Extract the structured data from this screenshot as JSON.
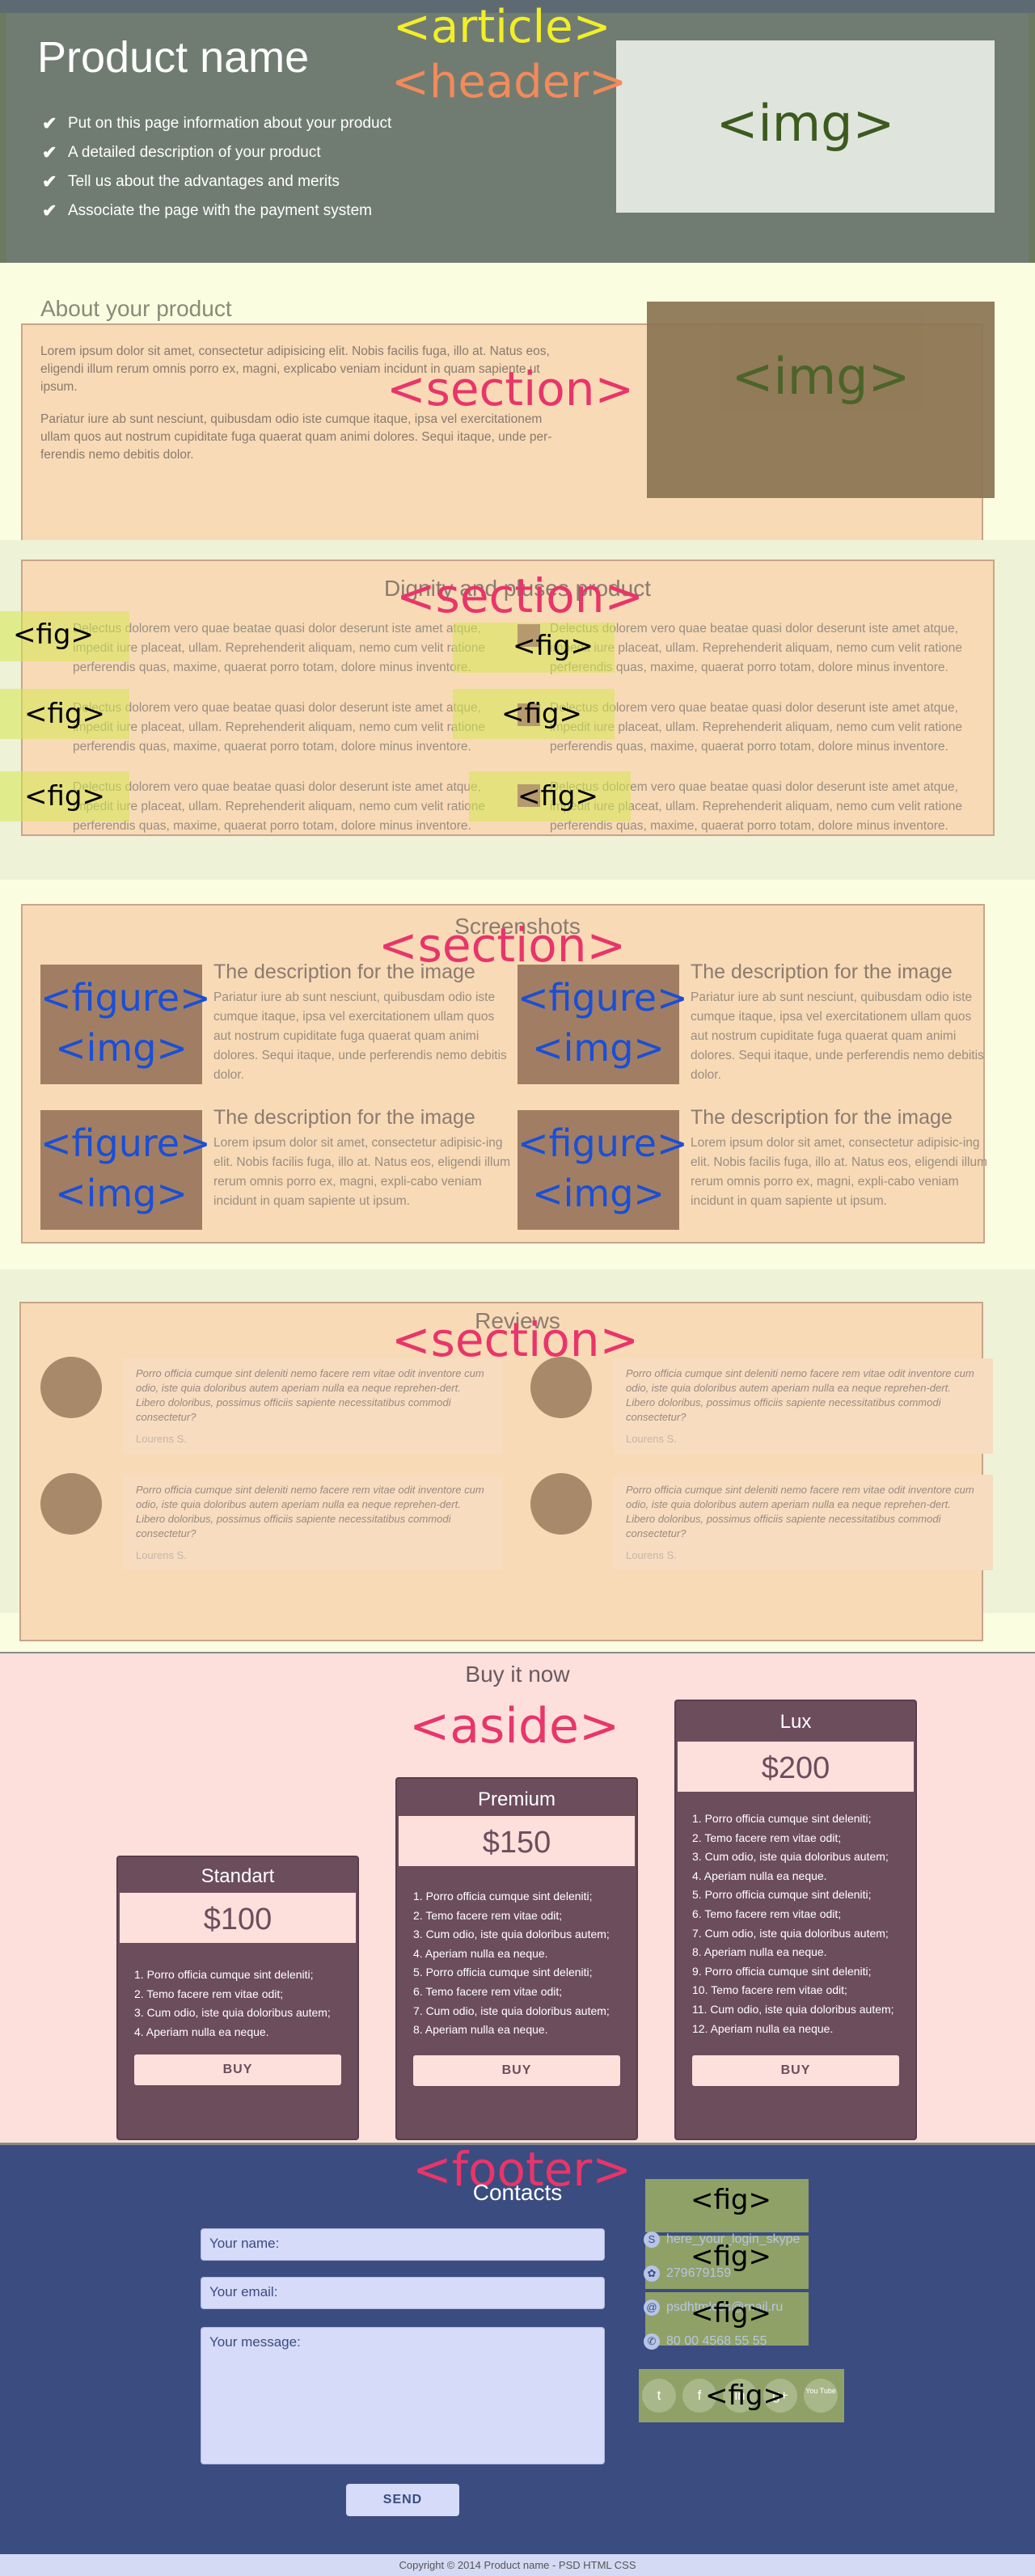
{
  "header": {
    "title": "Product name",
    "features": [
      "Put on this page information about your product",
      "A detailed description of your product",
      "Tell us about the advantages and merits",
      "Associate the page with the payment system"
    ],
    "img_label": "<img>"
  },
  "overlays": {
    "article": "<article>",
    "header": "<header>",
    "section": "<section>",
    "aside": "<aside>",
    "footer": "<footer>",
    "fig": "<fig>",
    "figure": "<figure>",
    "img": "<img>"
  },
  "about": {
    "title": "About your product",
    "p1": "Lorem ipsum dolor sit amet, consectetur adipisicing elit. Nobis facilis fuga, illo at. Natus eos, eligendi illum rerum omnis porro ex, magni, explicabo veniam incidunt in quam sapiente ut ipsum.",
    "p2": "Pariatur iure ab sunt nesciunt, quibusdam odio iste cumque itaque, ipsa vel exercitationem ullam quos aut nostrum cupiditate fuga quaerat quam animi dolores. Sequi itaque, unde per-ferendis nemo debitis dolor.",
    "img_label": "<img>"
  },
  "dignity": {
    "title": "Dignity and pluses product",
    "items": [
      "Delectus dolorem vero quae beatae quasi dolor deserunt iste amet atque, impedit iure placeat, ullam. Reprehenderit aliquam, nemo cum velit ratione perferendis quas, maxime, quaerat porro totam, dolore minus inventore.",
      "Delectus dolorem vero quae beatae quasi dolor deserunt iste amet atque, impedit iure placeat, ullam. Reprehenderit aliquam, nemo cum velit ratione perferendis quas, maxime, quaerat porro totam, dolore minus inventore.",
      "Delectus dolorem vero quae beatae quasi dolor deserunt iste amet atque, impedit iure placeat, ullam. Reprehenderit aliquam, nemo cum velit ratione perferendis quas, maxime, quaerat porro totam, dolore minus inventore.",
      "Delectus dolorem vero quae beatae quasi dolor deserunt iste amet atque, impedit iure placeat, ullam. Reprehenderit aliquam, nemo cum velit ratione perferendis quas, maxime, quaerat porro totam, dolore minus inventore.",
      "Delectus dolorem vero quae beatae quasi dolor deserunt iste amet atque, impedit iure placeat, ullam. Reprehenderit aliquam, nemo cum velit ratione perferendis quas, maxime, quaerat porro totam, dolore minus inventore.",
      "Delectus dolorem vero quae beatae quasi dolor deserunt iste amet atque, impedit iure placeat, ullam. Reprehenderit aliquam, nemo cum velit ratione perferendis quas, maxime, quaerat porro totam, dolore minus inventore."
    ]
  },
  "screenshots": {
    "title": "Screenshots",
    "items": [
      {
        "heading": "The description for the image",
        "text": "Pariatur iure ab sunt nesciunt, quibusdam odio iste cumque itaque, ipsa vel exercitationem ullam quos aut nostrum cupiditate fuga quaerat quam animi dolores. Sequi itaque, unde perferendis nemo debitis dolor."
      },
      {
        "heading": "The description for the image",
        "text": "Pariatur iure ab sunt nesciunt, quibusdam odio iste cumque itaque, ipsa vel exercitationem ullam quos aut nostrum cupiditate fuga quaerat quam animi dolores. Sequi itaque, unde perferendis nemo debitis dolor."
      },
      {
        "heading": "The description for the image",
        "text": "Lorem ipsum dolor sit amet, consectetur adipisic-ing elit. Nobis facilis fuga, illo at. Natus eos, eligendi illum rerum omnis porro ex, magni, expli-cabo veniam incidunt in quam sapiente ut ipsum."
      },
      {
        "heading": "The description for the image",
        "text": "Lorem ipsum dolor sit amet, consectetur adipisic-ing elit. Nobis facilis fuga, illo at. Natus eos, eligendi illum rerum omnis porro ex, magni, expli-cabo veniam incidunt in quam sapiente ut ipsum."
      }
    ]
  },
  "reviews": {
    "title": "Reviews",
    "items": [
      {
        "text": "Porro officia cumque sint deleniti nemo facere rem vitae odit inventore cum odio, iste quia doloribus autem aperiam nulla ea neque reprehen-dert. Libero doloribus, possimus officiis sapiente necessitatibus commodi consectetur?",
        "author": "Lourens S."
      },
      {
        "text": "Porro officia cumque sint deleniti nemo facere rem vitae odit inventore cum odio, iste quia doloribus autem aperiam nulla ea neque reprehen-dert. Libero doloribus, possimus officiis sapiente necessitatibus commodi consectetur?",
        "author": "Lourens S."
      },
      {
        "text": "Porro officia cumque sint deleniti nemo facere rem vitae odit inventore cum odio, iste quia doloribus autem aperiam nulla ea neque reprehen-dert. Libero doloribus, possimus officiis sapiente necessitatibus commodi consectetur?",
        "author": "Lourens S."
      },
      {
        "text": "Porro officia cumque sint deleniti nemo facere rem vitae odit inventore cum odio, iste quia doloribus autem aperiam nulla ea neque reprehen-dert. Libero doloribus, possimus officiis sapiente necessitatibus commodi consectetur?",
        "author": "Lourens S."
      }
    ]
  },
  "buy": {
    "title": "Buy it now",
    "plans": [
      {
        "name": "Standart",
        "price": "$100",
        "items": [
          "1. Porro officia cumque sint deleniti;",
          "2. Temo facere rem vitae odit;",
          "3. Cum odio, iste quia doloribus autem;",
          "4. Aperiam nulla ea neque."
        ],
        "button": "BUY"
      },
      {
        "name": "Premium",
        "price": "$150",
        "items": [
          "1. Porro officia cumque sint deleniti;",
          "2. Temo facere rem vitae odit;",
          "3. Cum odio, iste quia doloribus autem;",
          "4. Aperiam nulla ea neque.",
          "5. Porro officia cumque sint deleniti;",
          "6. Temo facere rem vitae odit;",
          "7. Cum odio, iste quia doloribus autem;",
          "8. Aperiam nulla ea neque."
        ],
        "button": "BUY"
      },
      {
        "name": "Lux",
        "price": "$200",
        "items": [
          "1. Porro officia cumque sint deleniti;",
          "2. Temo facere rem vitae odit;",
          "3. Cum odio, iste quia doloribus autem;",
          "4. Aperiam nulla ea neque.",
          "5. Porro officia cumque sint deleniti;",
          "6. Temo facere rem vitae odit;",
          "7. Cum odio, iste quia doloribus autem;",
          "8. Aperiam nulla ea neque.",
          "9. Porro officia cumque sint deleniti;",
          "10. Temo facere rem vitae odit;",
          "11. Cum odio, iste quia doloribus autem;",
          "12. Aperiam nulla ea neque."
        ],
        "button": "BUY"
      }
    ]
  },
  "footer": {
    "title": "Contacts",
    "name_placeholder": "Your name:",
    "email_placeholder": "Your email:",
    "message_placeholder": "Your message:",
    "send": "SEND",
    "skype": "here_your_login_skype",
    "icq": "279679159",
    "email": "psdhtmlcss@mail.ru",
    "phone": "80 00 4568 55 55",
    "socials": [
      "t",
      "f",
      "in",
      "g+",
      "You Tube"
    ],
    "copyright": "Copyright © 2014 Product name - PSD HTML CSS"
  }
}
